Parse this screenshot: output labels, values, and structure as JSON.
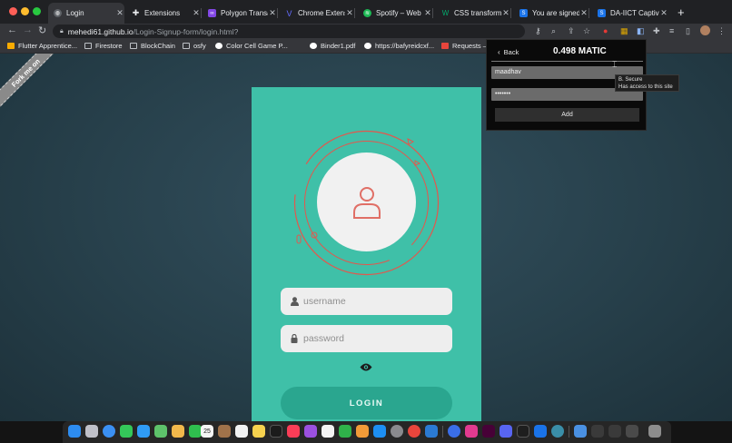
{
  "browser": {
    "tabs": [
      {
        "label": "Login",
        "active": true,
        "icon": "globe-icon",
        "color": "#5f6368"
      },
      {
        "label": "Extensions",
        "icon": "puzzle-icon",
        "color": "#202124"
      },
      {
        "label": "Polygon Transa",
        "icon": "polygon-icon",
        "color": "#8247e5"
      },
      {
        "label": "Chrome Extens",
        "icon": "vite-icon",
        "color": "#646cff"
      },
      {
        "label": "Spotify – Web P",
        "icon": "spotify-icon",
        "color": "#1db954"
      },
      {
        "label": "CSS transform",
        "icon": "w3-icon",
        "color": "#04aa6d"
      },
      {
        "label": "You are signed",
        "icon": "s-icon",
        "color": "#1a73e8"
      },
      {
        "label": "DA-IICT Captiv",
        "icon": "s-icon",
        "color": "#1a73e8"
      }
    ],
    "url": {
      "host": "mehedi61.github.io",
      "path": "/Login-Signup-form/login.html?"
    },
    "bookmarks": [
      {
        "label": "Flutter Apprentice...",
        "color": "#f9ab00"
      },
      {
        "label": "Firestore",
        "color": "#bdc1c6"
      },
      {
        "label": "BlockChain",
        "color": "#bdc1c6"
      },
      {
        "label": "osfy",
        "color": "#bdc1c6"
      },
      {
        "label": "Color Cell Game P...",
        "color": "#ffffff"
      },
      {
        "label": "Binder1.pdf",
        "color": "#ffffff"
      },
      {
        "label": "https://bafyreidcxf...",
        "color": "#ffffff"
      },
      {
        "label": "Requests –",
        "color": "#e8453c"
      }
    ]
  },
  "page": {
    "ribbon": "Fork me on",
    "username_placeholder": "username",
    "password_placeholder": "password",
    "login_label": "LOGIN",
    "colors": {
      "card": "#3fc0a8",
      "button": "#2aa68f",
      "ring": "#e3574d",
      "avatar_icon": "#e06f66"
    }
  },
  "popup": {
    "back_label": "Back",
    "balance": "0.498 MATIC",
    "name_value": "maadhav",
    "password_value": "•••••••",
    "add_label": "Add",
    "tooltip_title": "B. Secure",
    "tooltip_text": "Has access to this site"
  },
  "dock": {
    "calendar_day": "25"
  }
}
